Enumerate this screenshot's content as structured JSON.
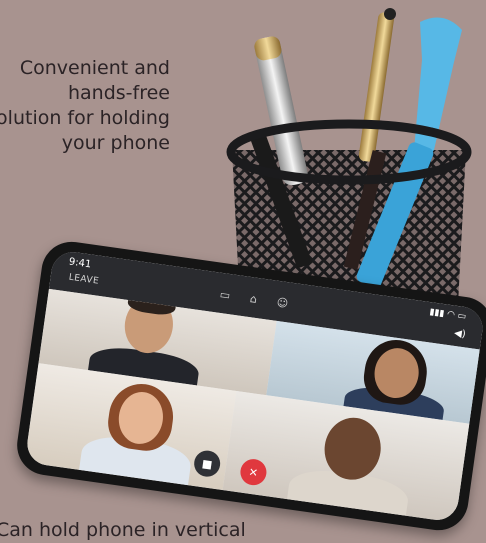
{
  "headline": {
    "line1": "Convenient and",
    "line2": "hands-free",
    "line3": "solution for holding",
    "line4": "your phone"
  },
  "bottom_text": "Can hold phone in vertical",
  "phone": {
    "status_time": "9:41",
    "leave_label": "LEAVE"
  },
  "icons": {
    "cast": "cast-icon",
    "home": "home-icon",
    "people": "people-icon",
    "video": "video-camera-icon",
    "mic": "mic-mute-icon",
    "speaker": "speaker-icon"
  },
  "colors": {
    "background": "#a8938f",
    "text": "#2b2326",
    "mute_button": "#e0383e",
    "pen_blue": "#57b8e6"
  }
}
